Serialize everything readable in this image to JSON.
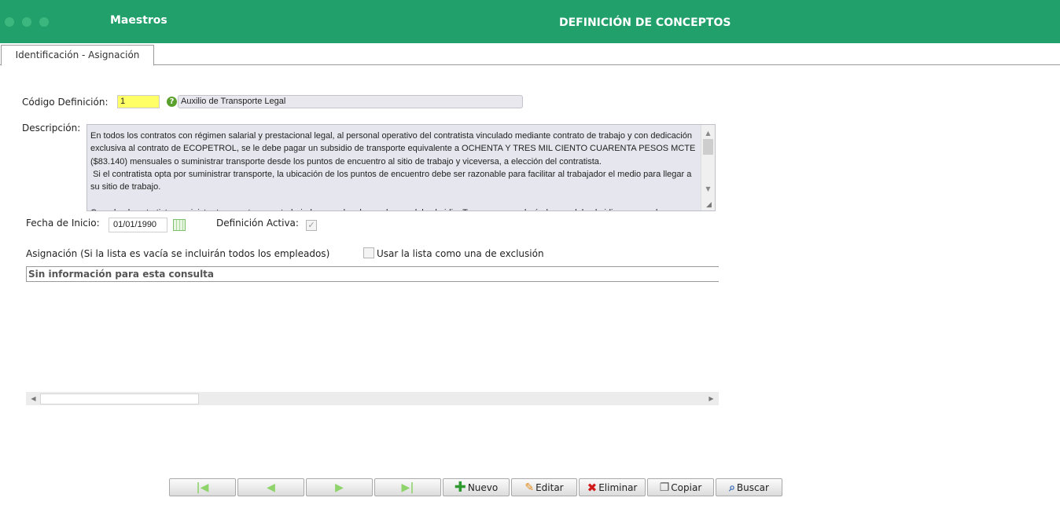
{
  "header": {
    "app_title": "Maestros",
    "page_title": "DEFINICIÓN DE CONCEPTOS",
    "brand_color": "#22a06b"
  },
  "tabs": [
    {
      "label": "Identificación - Asignación",
      "active": true
    }
  ],
  "form": {
    "codigo_label": "Código Definición:",
    "codigo_value": "1",
    "help_icon_glyph": "?",
    "nombre_value": "Auxilio de Transporte Legal",
    "descripcion_label": "Descripción:",
    "descripcion_value": "En todos los contratos con régimen salarial y prestacional legal, al personal operativo del contratista vinculado mediante contrato de trabajo y con dedicación exclusiva al contrato de ECOPETROL, se le debe pagar un subsidio de transporte equivalente a OCHENTA Y TRES MIL CIENTO CUARENTA PESOS MCTE ($83.140) mensuales o suministrar transporte desde los puntos de encuentro al sitio de trabajo y viceversa, a elección del contratista.\n Si el contratista opta por suministrar transporte, la ubicación de los puntos de encuentro debe ser razonable para facilitar al trabajador el medio para llegar a su sitio de trabajo.\n\nCuando el contratista suministre transporte a sus trabajadores no hay lugar al pago del subsidio. Tampoco procederá el pago del subsidio en caso de",
    "fecha_label": "Fecha de Inicio:",
    "fecha_value": "01/01/1990",
    "activa_label": "Definición Activa:",
    "activa_checked": true,
    "asignacion_label": "Asignación (Si la lista es vacía se incluirán todos los empleados)",
    "exclusion_label": "Usar la lista como una de exclusión",
    "exclusion_checked": false,
    "empty_message": "Sin información para esta consulta"
  },
  "toolbar": {
    "nuevo": "Nuevo",
    "editar": "Editar",
    "eliminar": "Eliminar",
    "copiar": "Copiar",
    "buscar": "Buscar"
  }
}
